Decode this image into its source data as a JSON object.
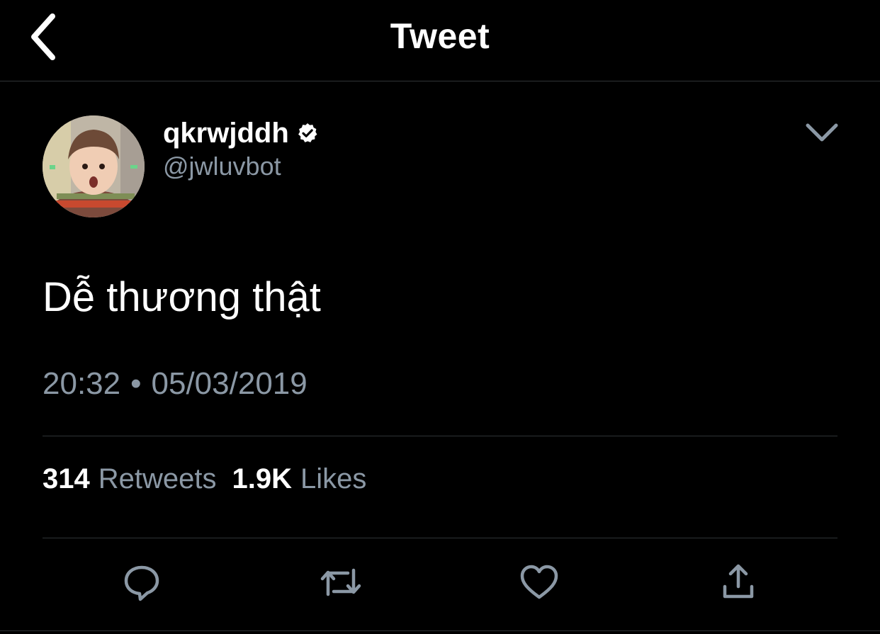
{
  "header": {
    "title": "Tweet",
    "back_icon": "chevron-left-icon"
  },
  "tweet": {
    "author": {
      "display_name": "qkrwjddh",
      "handle": "@jwluvbot",
      "verified": true
    },
    "text": "Dễ thương thật",
    "time": "20:32",
    "separator": "•",
    "date": "05/03/2019",
    "stats": {
      "retweets_count": "314",
      "retweets_label": "Retweets",
      "likes_count": "1.9K",
      "likes_label": "Likes"
    }
  },
  "actions": [
    {
      "icon": "reply-icon"
    },
    {
      "icon": "retweet-icon"
    },
    {
      "icon": "like-icon"
    },
    {
      "icon": "share-icon"
    }
  ],
  "colors": {
    "background": "#000000",
    "text_primary": "#ffffff",
    "text_secondary": "#8b98a5",
    "divider": "#2f3336"
  }
}
